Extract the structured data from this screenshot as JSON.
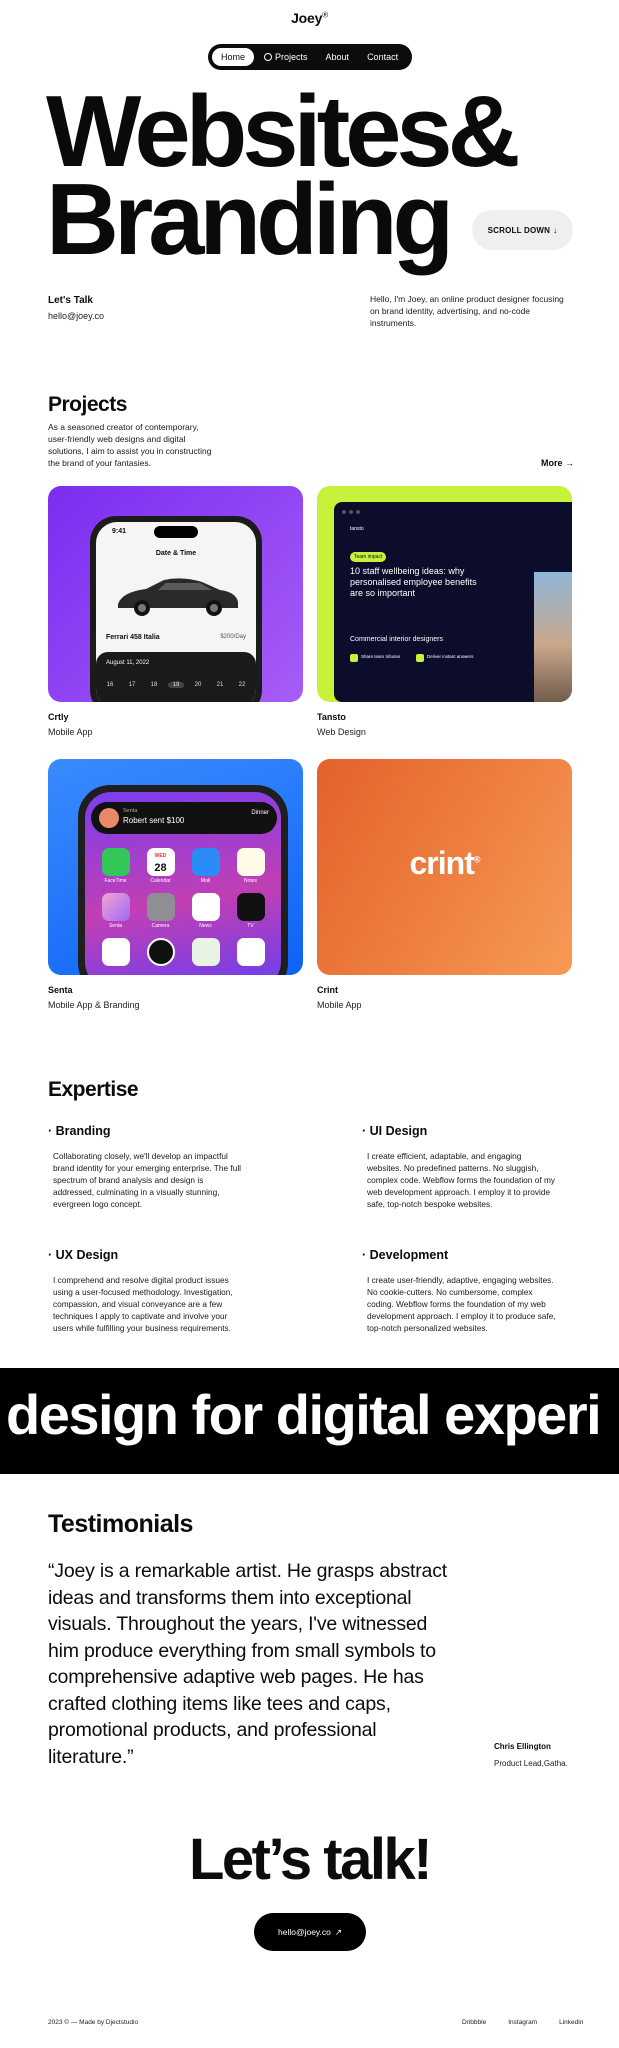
{
  "header": {
    "logo": "Joey",
    "logo_mark": "®",
    "nav": [
      {
        "label": "Home",
        "active": true
      },
      {
        "label": "Projects",
        "icon": "globe-icon"
      },
      {
        "label": "About"
      },
      {
        "label": "Contact"
      }
    ]
  },
  "hero": {
    "line1": "Websites&",
    "line2": "Branding",
    "scroll_label": "SCROLL DOWN",
    "scroll_icon": "arrow-down-icon"
  },
  "contact_intro": {
    "label": "Let's Talk",
    "email": "hello@joey.co",
    "intro": "Hello, I'm Joey, an online product designer focusing on brand identity, advertising, and no-code instruments."
  },
  "projects": {
    "title": "Projects",
    "description": "As a seasoned creator of contemporary, user-friendly web designs and digital solutions, I aim to assist you in constructing the brand of your fantasies.",
    "more_label": "More",
    "items": [
      {
        "name": "Crtly",
        "type": "Mobile App"
      },
      {
        "name": "Tansto",
        "type": "Web Design"
      },
      {
        "name": "Senta",
        "type": "Mobile App & Branding"
      },
      {
        "name": "Crint",
        "type": "Mobile App"
      }
    ],
    "crtly_mock": {
      "time": "9:41",
      "header": "Date & Time",
      "car": "Ferrari 458 Italia",
      "price": "$200/Day",
      "date": "August 11, 2022",
      "days": [
        "16",
        "17",
        "18",
        "19",
        "20",
        "21",
        "22"
      ]
    },
    "tansto_mock": {
      "brand": "tansto",
      "tag": "Team impact",
      "title": "10 staff wellbeing ideas: why personalised employee benefits are so important",
      "subtitle": "Commercial interior designers",
      "item1": "Share team tributes",
      "item2": "Deliver instant answers"
    },
    "senta_mock": {
      "app_name": "Senta",
      "message": "Robert sent $100",
      "side": "Dinner",
      "month": "WED",
      "day_num": "28",
      "apps": [
        "FaceTime",
        "Calendar",
        "Mail",
        "Notes",
        "Senta",
        "Camera",
        "News",
        "TV"
      ]
    },
    "crint_logo": "crint",
    "crint_mark": "®"
  },
  "expertise": {
    "title": "Expertise",
    "items": [
      {
        "title": "Branding",
        "text": "Collaborating closely, we'll develop an impactful brand identity for your emerging enterprise. The full spectrum of brand analysis and design is addressed, culminating in a visually stunning, evergreen logo concept."
      },
      {
        "title": "UI Design",
        "text": "I create efficient, adaptable, and engaging websites. No predefined patterns. No sluggish, complex code. Webflow forms the foundation of my web development approach. I employ it to provide safe, top-notch bespoke websites."
      },
      {
        "title": "UX Design",
        "text": "I comprehend and resolve digital product issues using a user-focused methodology. Investigation, compassion, and visual conveyance are a few techniques I apply to captivate and involve your users while fulfilling your business requirements."
      },
      {
        "title": "Development",
        "text": "I create user-friendly, adaptive, engaging websites. No cookie-cutters. No cumbersome, complex coding. Webflow forms the foundation of my web development approach. I employ it to produce safe, top-notch personalized websites."
      }
    ]
  },
  "marquee": {
    "text": "design for digital experi"
  },
  "testimonials": {
    "title": "Testimonials",
    "quote": "“Joey is a remarkable artist. He grasps abstract ideas and transforms them into exceptional visuals. Throughout the years, I've witnessed him produce everything from small symbols to comprehensive adaptive web pages. He has crafted clothing items like tees and caps, promotional products, and professional literature.”",
    "author": "Chris Ellington",
    "role": "Product Lead,Gatha."
  },
  "cta": {
    "heading": "Let’s talk!",
    "email_button": "hello@joey.co",
    "email_icon": "arrow-up-right-icon"
  },
  "footer": {
    "copyright": "2023 © — Made by Djectstudio",
    "links": [
      "Dribbble",
      "Instagram",
      "Linkedin"
    ]
  }
}
